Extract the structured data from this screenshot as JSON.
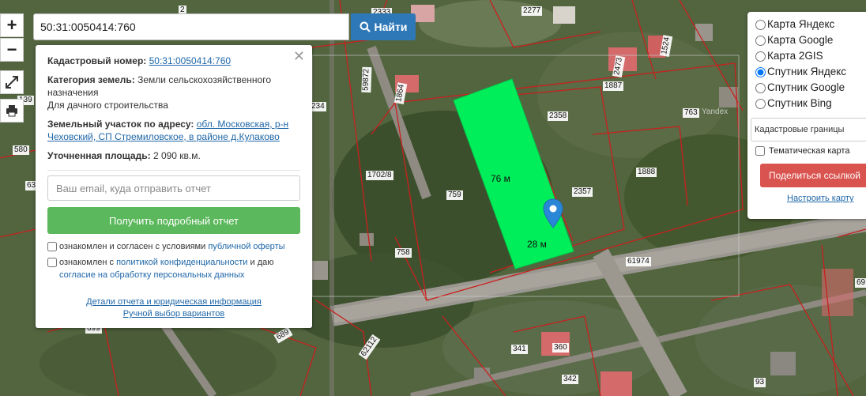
{
  "search": {
    "value": "50:31:0050414:760",
    "button_label": "Найти"
  },
  "zoom": {
    "plus": "+",
    "minus": "−"
  },
  "tools": {
    "fullscreen_icon": "expand-icon",
    "print_icon": "printer-icon"
  },
  "info": {
    "cadastral_label": "Кадастровый номер:",
    "cadastral_value": "50:31:0050414:760",
    "category_label": "Категория земель:",
    "category_value": "Земли сельскохозяйственного назначения",
    "use_value": "Для дачного строительства",
    "address_label": "Земельный участок по адресу:",
    "address_value": "обл. Московская, р-н Чеховский, СП Стремиловское, в районе д.Кулаково",
    "area_label": "Уточненная площадь:",
    "area_value": "2 090 кв.м.",
    "email_placeholder": "Ваш email, куда отправить отчет",
    "report_button": "Получить подробный отчет",
    "agree1_prefix": "ознакомлен и согласен с условиями",
    "agree1_link": "публичной оферты",
    "agree2_prefix": "ознакомлен с",
    "agree2_link": "политикой конфиденциальности",
    "agree2_mid": "и даю",
    "agree2_link2": "согласие на обработку персональных данных",
    "details_link": "Детали отчета и юридическая информация",
    "manual_link": "Ручной выбор вариантов"
  },
  "layers": {
    "options": [
      {
        "label": "Карта Яндекс",
        "checked": false
      },
      {
        "label": "Карта Google",
        "checked": false
      },
      {
        "label": "Карта 2GIS",
        "checked": false
      },
      {
        "label": "Спутник Яндекс",
        "checked": true
      },
      {
        "label": "Спутник Google",
        "checked": false
      },
      {
        "label": "Спутник Bing",
        "checked": false
      }
    ],
    "select_value": "Кадастровые границы",
    "thematic_label": "Тематическая карта",
    "share_button": "Поделиться ссылкой",
    "setup_link": "Настроить карту"
  },
  "map": {
    "watermark": "Yandex",
    "dimension_length": "76 м",
    "dimension_width": "28 м",
    "parcel_labels": [
      "2",
      "2333",
      "2277",
      "1524",
      "2473",
      "1887",
      "2358",
      "763",
      "59872",
      "1864",
      "234",
      "139",
      "580",
      "63",
      "1702/8",
      "759",
      "2357",
      "1888",
      "758",
      "61974",
      "699",
      "689",
      "62112",
      "341",
      "360",
      "342",
      "93",
      "69"
    ]
  }
}
